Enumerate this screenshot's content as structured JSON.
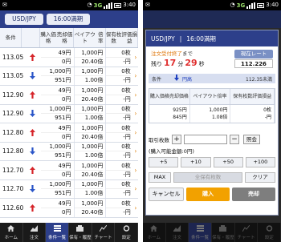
{
  "status": {
    "time": "3:40",
    "network": "3G"
  },
  "left": {
    "symbol": "USD/JPY",
    "duration": "16:00満期",
    "headers": {
      "strike": "条件",
      "price": [
        "購入価格",
        "売却価格"
      ],
      "payout": [
        "ペイアウト",
        "倍率"
      ],
      "holding": [
        "保有枚数",
        "評価損益"
      ]
    },
    "rows": [
      {
        "strike": "113.05",
        "dir": "up",
        "price": [
          "49円",
          "0円"
        ],
        "payout": [
          "1,000円",
          "20.40倍"
        ],
        "holding": [
          "0枚",
          "-円"
        ]
      },
      {
        "strike": "113.05",
        "dir": "down",
        "price": [
          "1,000円",
          "951円"
        ],
        "payout": [
          "1,000円",
          "1.00倍"
        ],
        "holding": [
          "0枚",
          "-円"
        ]
      },
      {
        "strike": "112.90",
        "dir": "up",
        "price": [
          "49円",
          "0円"
        ],
        "payout": [
          "1,000円",
          "20.40倍"
        ],
        "holding": [
          "0枚",
          "-円"
        ]
      },
      {
        "strike": "112.90",
        "dir": "down",
        "price": [
          "1,000円",
          "951円"
        ],
        "payout": [
          "1,000円",
          "1.00倍"
        ],
        "holding": [
          "0枚",
          "-円"
        ]
      },
      {
        "strike": "112.80",
        "dir": "up",
        "price": [
          "49円",
          "0円"
        ],
        "payout": [
          "1,000円",
          "20.40倍"
        ],
        "holding": [
          "0枚",
          "-円"
        ]
      },
      {
        "strike": "112.80",
        "dir": "down",
        "price": [
          "1,000円",
          "951円"
        ],
        "payout": [
          "1,000円",
          "1.00倍"
        ],
        "holding": [
          "0枚",
          "-円"
        ]
      },
      {
        "strike": "112.70",
        "dir": "up",
        "price": [
          "49円",
          "0円"
        ],
        "payout": [
          "1,000円",
          "20.40倍"
        ],
        "holding": [
          "0枚",
          "-円"
        ]
      },
      {
        "strike": "112.70",
        "dir": "down",
        "price": [
          "1,000円",
          "951円"
        ],
        "payout": [
          "1,000円",
          "1.00倍"
        ],
        "holding": [
          "0枚",
          "-円"
        ]
      },
      {
        "strike": "112.60",
        "dir": "up",
        "price": [
          "49円",
          "0円"
        ],
        "payout": [
          "1,000円",
          "20.40倍"
        ],
        "holding": [
          "0枚",
          "-円"
        ]
      }
    ]
  },
  "tabs": [
    "ホーム",
    "注文",
    "条件一覧",
    "保有・履歴",
    "チャート",
    "設定"
  ],
  "right": {
    "symbol": "USD/JPY",
    "duration": "16:00満期",
    "deadline_label": "注文受付終了",
    "deadline_suffix": "まで",
    "remain_prefix": "残り",
    "remain_min": "17",
    "remain_min_unit": "分",
    "remain_sec": "29",
    "remain_sec_unit": "秒",
    "rate_button": "現在レート",
    "rate_value": "112.226",
    "cond_label": "条件",
    "cond_dir": "円高",
    "cond_value": "112.35未満",
    "table_headers": {
      "price": [
        "購入価格",
        "売却価格"
      ],
      "payout": [
        "ペイアウト",
        "倍率"
      ],
      "holding": [
        "保有枚数",
        "評価損益"
      ]
    },
    "table_row": {
      "price": [
        "925円",
        "845円"
      ],
      "payout": [
        "1,000円",
        "1.08倍"
      ],
      "holding": [
        "0枚",
        "-円"
      ]
    },
    "qty_label": "取引枚数",
    "plus": "+",
    "minus": "−",
    "ref_label": "照会",
    "avail_label": "(購入可能金額:",
    "avail_value": "0円)",
    "increments": [
      "+5",
      "+10",
      "+50",
      "+100"
    ],
    "max_label": "MAX",
    "all_label": "全保有枚数",
    "clear_label": "クリア",
    "cancel_label": "キャンセル",
    "buy_label": "購入",
    "sell_label": "売却"
  }
}
